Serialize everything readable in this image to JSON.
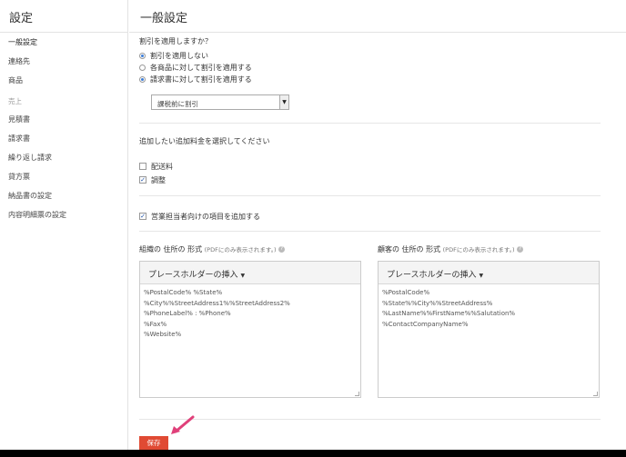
{
  "sidebar": {
    "title": "設定",
    "items_top": [
      {
        "label": "一般設定",
        "active": true
      },
      {
        "label": "連絡先"
      },
      {
        "label": "商品"
      }
    ],
    "section_sales": "売上",
    "items_sales": [
      {
        "label": "見積書"
      },
      {
        "label": "請求書"
      },
      {
        "label": "繰り返し請求"
      },
      {
        "label": "貸方票"
      },
      {
        "label": "納品書の設定"
      },
      {
        "label": "内容明細票の設定"
      }
    ]
  },
  "main": {
    "title": "一般設定",
    "discount": {
      "question": "割引を適用しますか？",
      "options": [
        {
          "label": "割引を適用しない",
          "checked": true
        },
        {
          "label": "各商品に対して割引を適用する",
          "checked": false
        },
        {
          "label": "請求書に対して割引を適用する",
          "checked": true
        }
      ],
      "select_value": "課税前に割引"
    },
    "charges": {
      "question": "追加したい追加料金を選択してください",
      "items": [
        {
          "label": "配送料",
          "checked": false
        },
        {
          "label": "調整",
          "checked": true
        }
      ]
    },
    "salesperson": {
      "label": "営業担当者向けの項目を追加する",
      "checked": true
    },
    "org_address": {
      "label": "組織の 住所の 形式",
      "note": "(PDFにのみ表示されます。)",
      "placeholder_button": "プレースホルダーの挿入",
      "text": "%PostalCode% %State%\n%City%%StreetAddress1%%StreetAddress2%\n%PhoneLabel% : %Phone%\n%Fax%\n%Website%"
    },
    "customer_address": {
      "label": "顧客の 住所の 形式",
      "note": "(PDFにのみ表示されます。)",
      "placeholder_button": "プレースホルダーの挿入",
      "text": "%PostalCode%\n%State%%City%%StreetAddress%\n%LastName%%FirstName%%Salutation%\n%ContactCompanyName%"
    },
    "save_label": "保存"
  },
  "colors": {
    "accent": "#3b7dd8",
    "save": "#e04a33",
    "annotation_arrow": "#e0407a"
  }
}
